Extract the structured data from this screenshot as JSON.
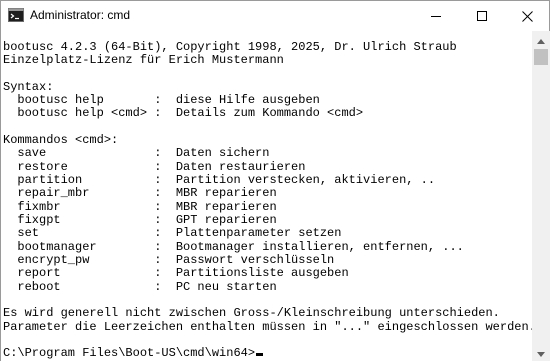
{
  "window": {
    "title": "Administrator: cmd"
  },
  "icons": {
    "app": "console-icon",
    "minimize": "minimize-icon",
    "maximize": "maximize-icon",
    "close": "close-icon",
    "scroll_up": "scroll-up-arrow-icon",
    "scroll_down": "scroll-down-arrow-icon"
  },
  "colors": {
    "console_background": "#ffffff",
    "console_text": "#000000",
    "scrollbar_track": "#f0f0f0",
    "scrollbar_thumb": "#c1c1c1"
  },
  "console": {
    "lines": [
      "bootusc 4.2.3 (64-Bit), Copyright 1998, 2025, Dr. Ulrich Straub",
      "Einzelplatz-Lizenz für Erich Mustermann",
      "",
      "Syntax:",
      "  bootusc help       :  diese Hilfe ausgeben",
      "  bootusc help <cmd> :  Details zum Kommando <cmd>",
      "",
      "Kommandos <cmd>:",
      "  save               :  Daten sichern",
      "  restore            :  Daten restaurieren",
      "  partition          :  Partition verstecken, aktivieren, ..",
      "  repair_mbr         :  MBR reparieren",
      "  fixmbr             :  MBR reparieren",
      "  fixgpt             :  GPT reparieren",
      "  set                :  Plattenparameter setzen",
      "  bootmanager        :  Bootmanager installieren, entfernen, ...",
      "  encrypt_pw         :  Passwort verschlüsseln",
      "  report             :  Partitionsliste ausgeben",
      "  reboot             :  PC neu starten",
      "",
      "Es wird generell nicht zwischen Gross-/Kleinschreibung unterschieden.",
      "Parameter die Leerzeichen enthalten müssen in \"...\" eingeschlossen werden.",
      "",
      "C:\\Program Files\\Boot-US\\cmd\\win64>"
    ]
  }
}
